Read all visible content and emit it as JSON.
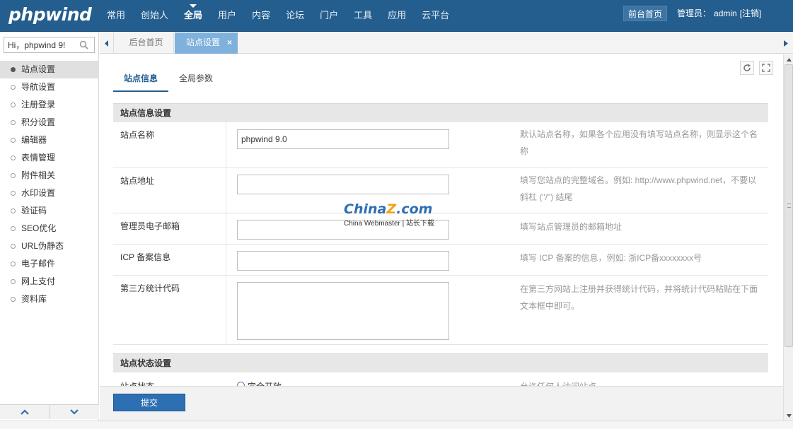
{
  "brand": {
    "logo": "phpwind"
  },
  "topnav": {
    "items": [
      "常用",
      "创始人",
      "全局",
      "用户",
      "内容",
      "论坛",
      "门户",
      "工具",
      "应用",
      "云平台"
    ],
    "active_index": 2,
    "front_page": "前台首页",
    "admin_label": "管理员：",
    "admin_name": "admin",
    "logout": "[注销]"
  },
  "sidebar": {
    "search_value": "Hi，phpwind 9!",
    "items": [
      "站点设置",
      "导航设置",
      "注册登录",
      "积分设置",
      "编辑器",
      "表情管理",
      "附件相关",
      "水印设置",
      "验证码",
      "SEO优化",
      "URL伪静态",
      "电子邮件",
      "网上支付",
      "资料库"
    ],
    "active_index": 0
  },
  "tabs": {
    "home": "后台首页",
    "current": "站点设置",
    "close_glyph": "×"
  },
  "subtabs": [
    "站点信息",
    "全局参数"
  ],
  "section1": {
    "title": "站点信息设置",
    "rows": [
      {
        "label": "站点名称",
        "value": "phpwind 9.0",
        "hint": "默认站点名称，如果各个应用没有填写站点名称，则显示这个名称"
      },
      {
        "label": "站点地址",
        "value": "",
        "hint": "填写您站点的完整域名。例如: http://www.phpwind.net，不要以斜杠 (\"/\") 结尾"
      },
      {
        "label": "管理员电子邮箱",
        "value": "",
        "hint": "填写站点管理员的邮箱地址"
      },
      {
        "label": "ICP 备案信息",
        "value": "",
        "hint": "填写 ICP 备案的信息，例如: 浙ICP备xxxxxxxx号"
      },
      {
        "label": "第三方统计代码",
        "value": "",
        "hint": "在第三方网站上注册并获得统计代码，并将统计代码粘贴在下面文本框中即可。"
      }
    ]
  },
  "section2": {
    "title": "站点状态设置",
    "partial_row": {
      "label": "站点状态",
      "option": "完全开放",
      "hint": "允许任何人访问站点"
    }
  },
  "watermark": {
    "logo_main": "China",
    "logo_z": "Z",
    "logo_tail": ".com",
    "sub": "China Webmaster | 站长下载"
  },
  "actions": {
    "submit": "提交"
  },
  "colors": {
    "topbar": "#245e8e",
    "accent": "#7fb1dc",
    "submit": "#2d6fb3"
  }
}
